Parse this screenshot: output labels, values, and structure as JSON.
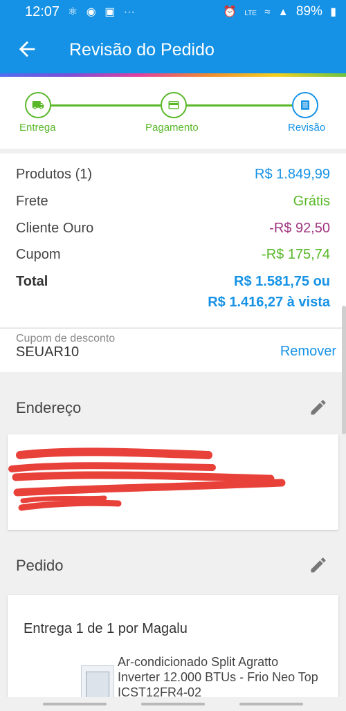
{
  "status_bar": {
    "time": "12:07",
    "left_icons": [
      "notification-icon",
      "chrome-icon",
      "image-icon",
      "more-dots-icon"
    ],
    "right_icons": [
      "alarm-icon",
      "volte-icon",
      "wifi-icon",
      "signal-icon",
      "battery-icon"
    ],
    "battery": "89%"
  },
  "app_bar": {
    "title": "Revisão do Pedido"
  },
  "stepper": {
    "steps": [
      {
        "label": "Entrega",
        "icon": "truck-icon"
      },
      {
        "label": "Pagamento",
        "icon": "card-icon"
      },
      {
        "label": "Revisão",
        "icon": "list-icon"
      }
    ],
    "color": "#58b828",
    "active_color": "#1592e6"
  },
  "summary": {
    "rows": [
      {
        "label": "Produtos (1)",
        "value": "R$ 1.849,99",
        "color": "#1592e6"
      },
      {
        "label": "Frete",
        "value": "Grátis",
        "color": "#58b828"
      },
      {
        "label": "Cliente Ouro",
        "value": "-R$ 92,50",
        "color": "#a0337e"
      },
      {
        "label": "Cupom",
        "value": "-R$ 175,74",
        "color": "#58b828"
      }
    ],
    "total_label": "Total",
    "total_line1": "R$ 1.581,75 ou",
    "total_line2": "R$ 1.416,27 à vista"
  },
  "coupon": {
    "label": "Cupom de desconto",
    "value": "SEUAR10",
    "remove": "Remover"
  },
  "address_section": {
    "title": "Endereço"
  },
  "order_section": {
    "title": "Pedido",
    "delivery": "Entrega 1 de 1 por Magalu",
    "product_name": "Ar-condicionado Split Agratto Inverter 12.000 BTUs - Frio Neo Top ICST12FR4-02"
  },
  "colors": {
    "primary": "#1592e6",
    "green": "#58b828",
    "purple": "#a0337e",
    "redaction": "#e8413a"
  }
}
